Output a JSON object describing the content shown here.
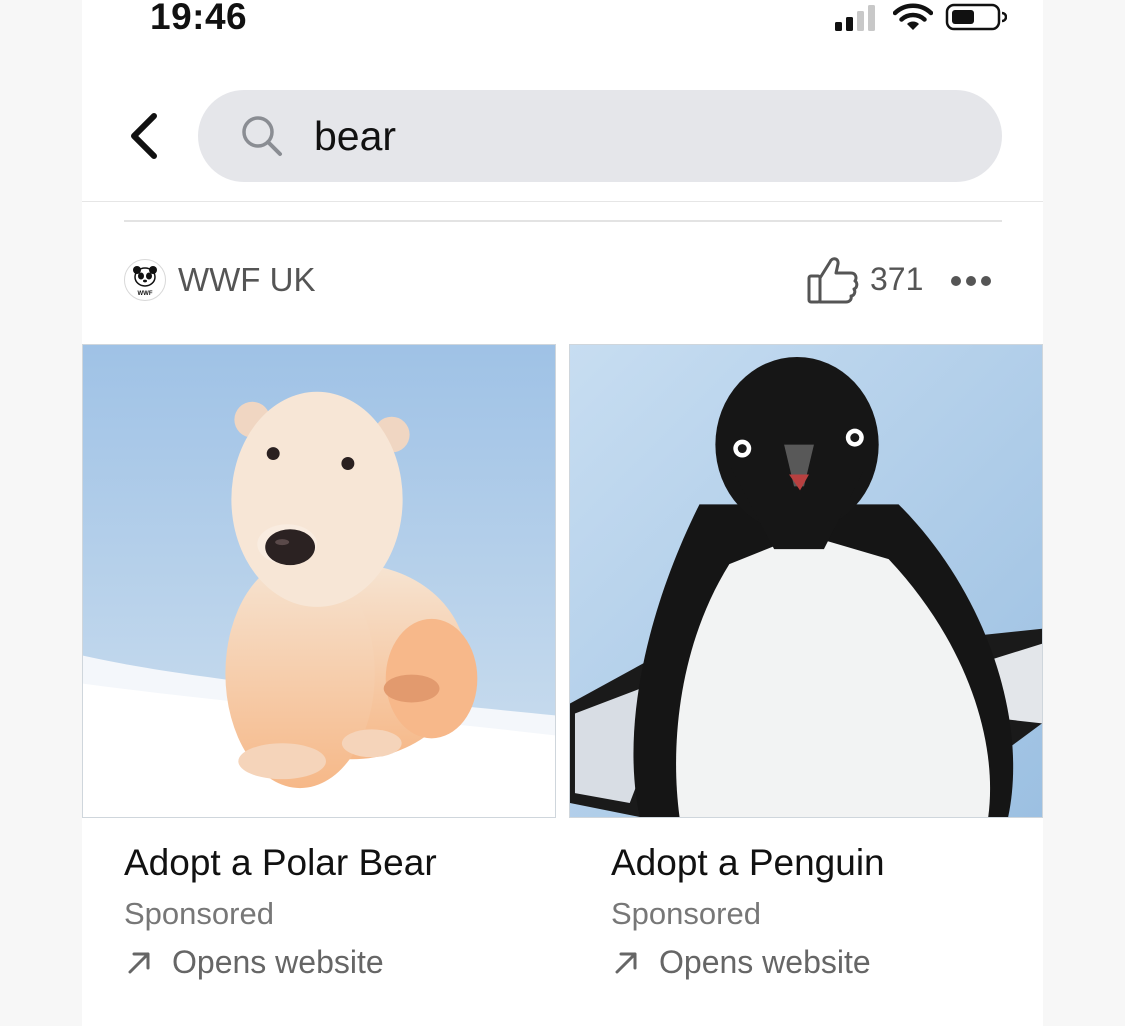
{
  "status_bar": {
    "time": "19:46"
  },
  "search": {
    "value": "bear",
    "placeholder": ""
  },
  "advertiser": {
    "name": "WWF UK",
    "logo_text": "WWF",
    "like_count": "371"
  },
  "cards": [
    {
      "title": "Adopt a Polar Bear",
      "label": "Sponsored",
      "link_text": "Opens website"
    },
    {
      "title": "Adopt a Penguin",
      "label": "Sponsored",
      "link_text": "Opens website"
    }
  ],
  "icons": {
    "back": "chevron-left-icon",
    "search": "search-icon",
    "like": "thumbs-up-icon",
    "more": "more-horizontal-icon",
    "link": "arrow-up-right-icon"
  },
  "colors": {
    "search_bg": "#e5e6ea",
    "text_primary": "#111111",
    "text_secondary": "#777777",
    "sky": "#a8c8e8"
  }
}
